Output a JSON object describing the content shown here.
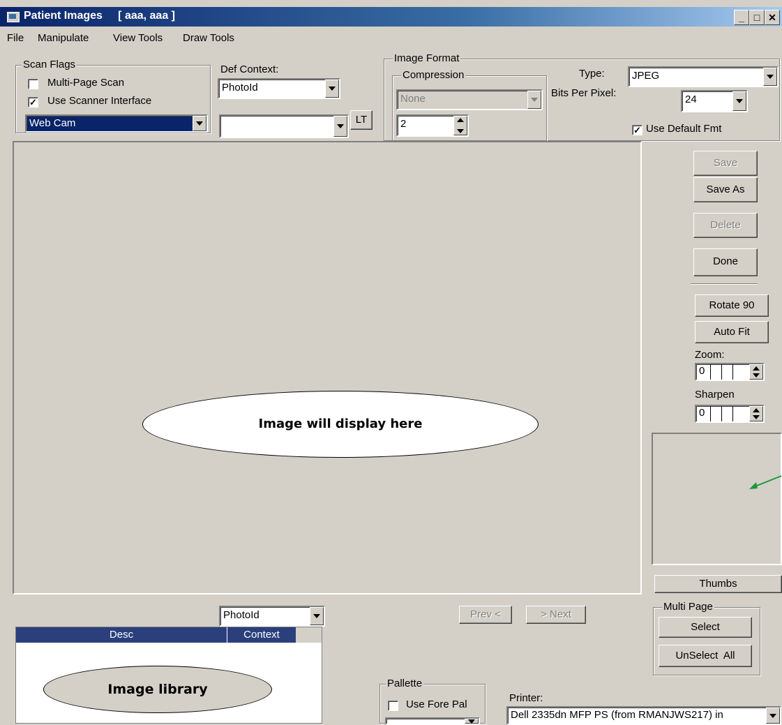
{
  "window": {
    "title": "Patient Images",
    "patient": "[ aaa, aaa ]"
  },
  "menu": [
    "File",
    "Manipulate",
    "View Tools",
    "Draw Tools"
  ],
  "scan_flags": {
    "label": "Scan Flags",
    "multi_page_label": "Multi-Page Scan",
    "multi_page_checked": false,
    "scanner_interface_label": "Use Scanner Interface",
    "scanner_interface_checked": true,
    "source": "Web Cam"
  },
  "def_context": {
    "label": "Def Context:",
    "value": "PhotoId",
    "second_value": "",
    "lt_label": "LT"
  },
  "image_format": {
    "label": "Image Format",
    "compression_label": "Compression",
    "compression_value": "None",
    "quality_value": "2",
    "type_label": "Type:",
    "type_value": "JPEG",
    "bpp_label": "Bits Per Pixel:",
    "bpp_value": "24",
    "use_default_label": "Use Default Fmt",
    "use_default_checked": true
  },
  "viewer": {
    "callout": "Image will display here"
  },
  "actions": {
    "save": "Save",
    "save_as": "Save As",
    "delete": "Delete",
    "done": "Done",
    "rotate": "Rotate 90",
    "auto_fit": "Auto Fit",
    "zoom_label": "Zoom:",
    "zoom_value": "0",
    "sharpen_label": "Sharpen",
    "sharpen_value": "0",
    "thumbs": "Thumbs"
  },
  "multi_page": {
    "label": "Multi Page",
    "select": "Select",
    "unselect_all": "UnSelect  All"
  },
  "library": {
    "filter_value": "PhotoId",
    "columns": [
      "Desc",
      "Context"
    ],
    "callout": "Image library"
  },
  "nav": {
    "prev": "Prev <",
    "next": "> Next"
  },
  "pallette": {
    "label": "Pallette",
    "use_fore_label": "Use Fore Pal",
    "use_fore_checked": false,
    "value": ""
  },
  "printer": {
    "label": "Printer:",
    "value": "Dell 2335dn MFP PS (from RMANJWS217) in"
  },
  "colors": {
    "title_start": "#0a246a",
    "title_end": "#a6caf0",
    "face": "#d4d0c8",
    "grid_header": "#2a3f7c",
    "arrow": "#1a9a3a"
  }
}
